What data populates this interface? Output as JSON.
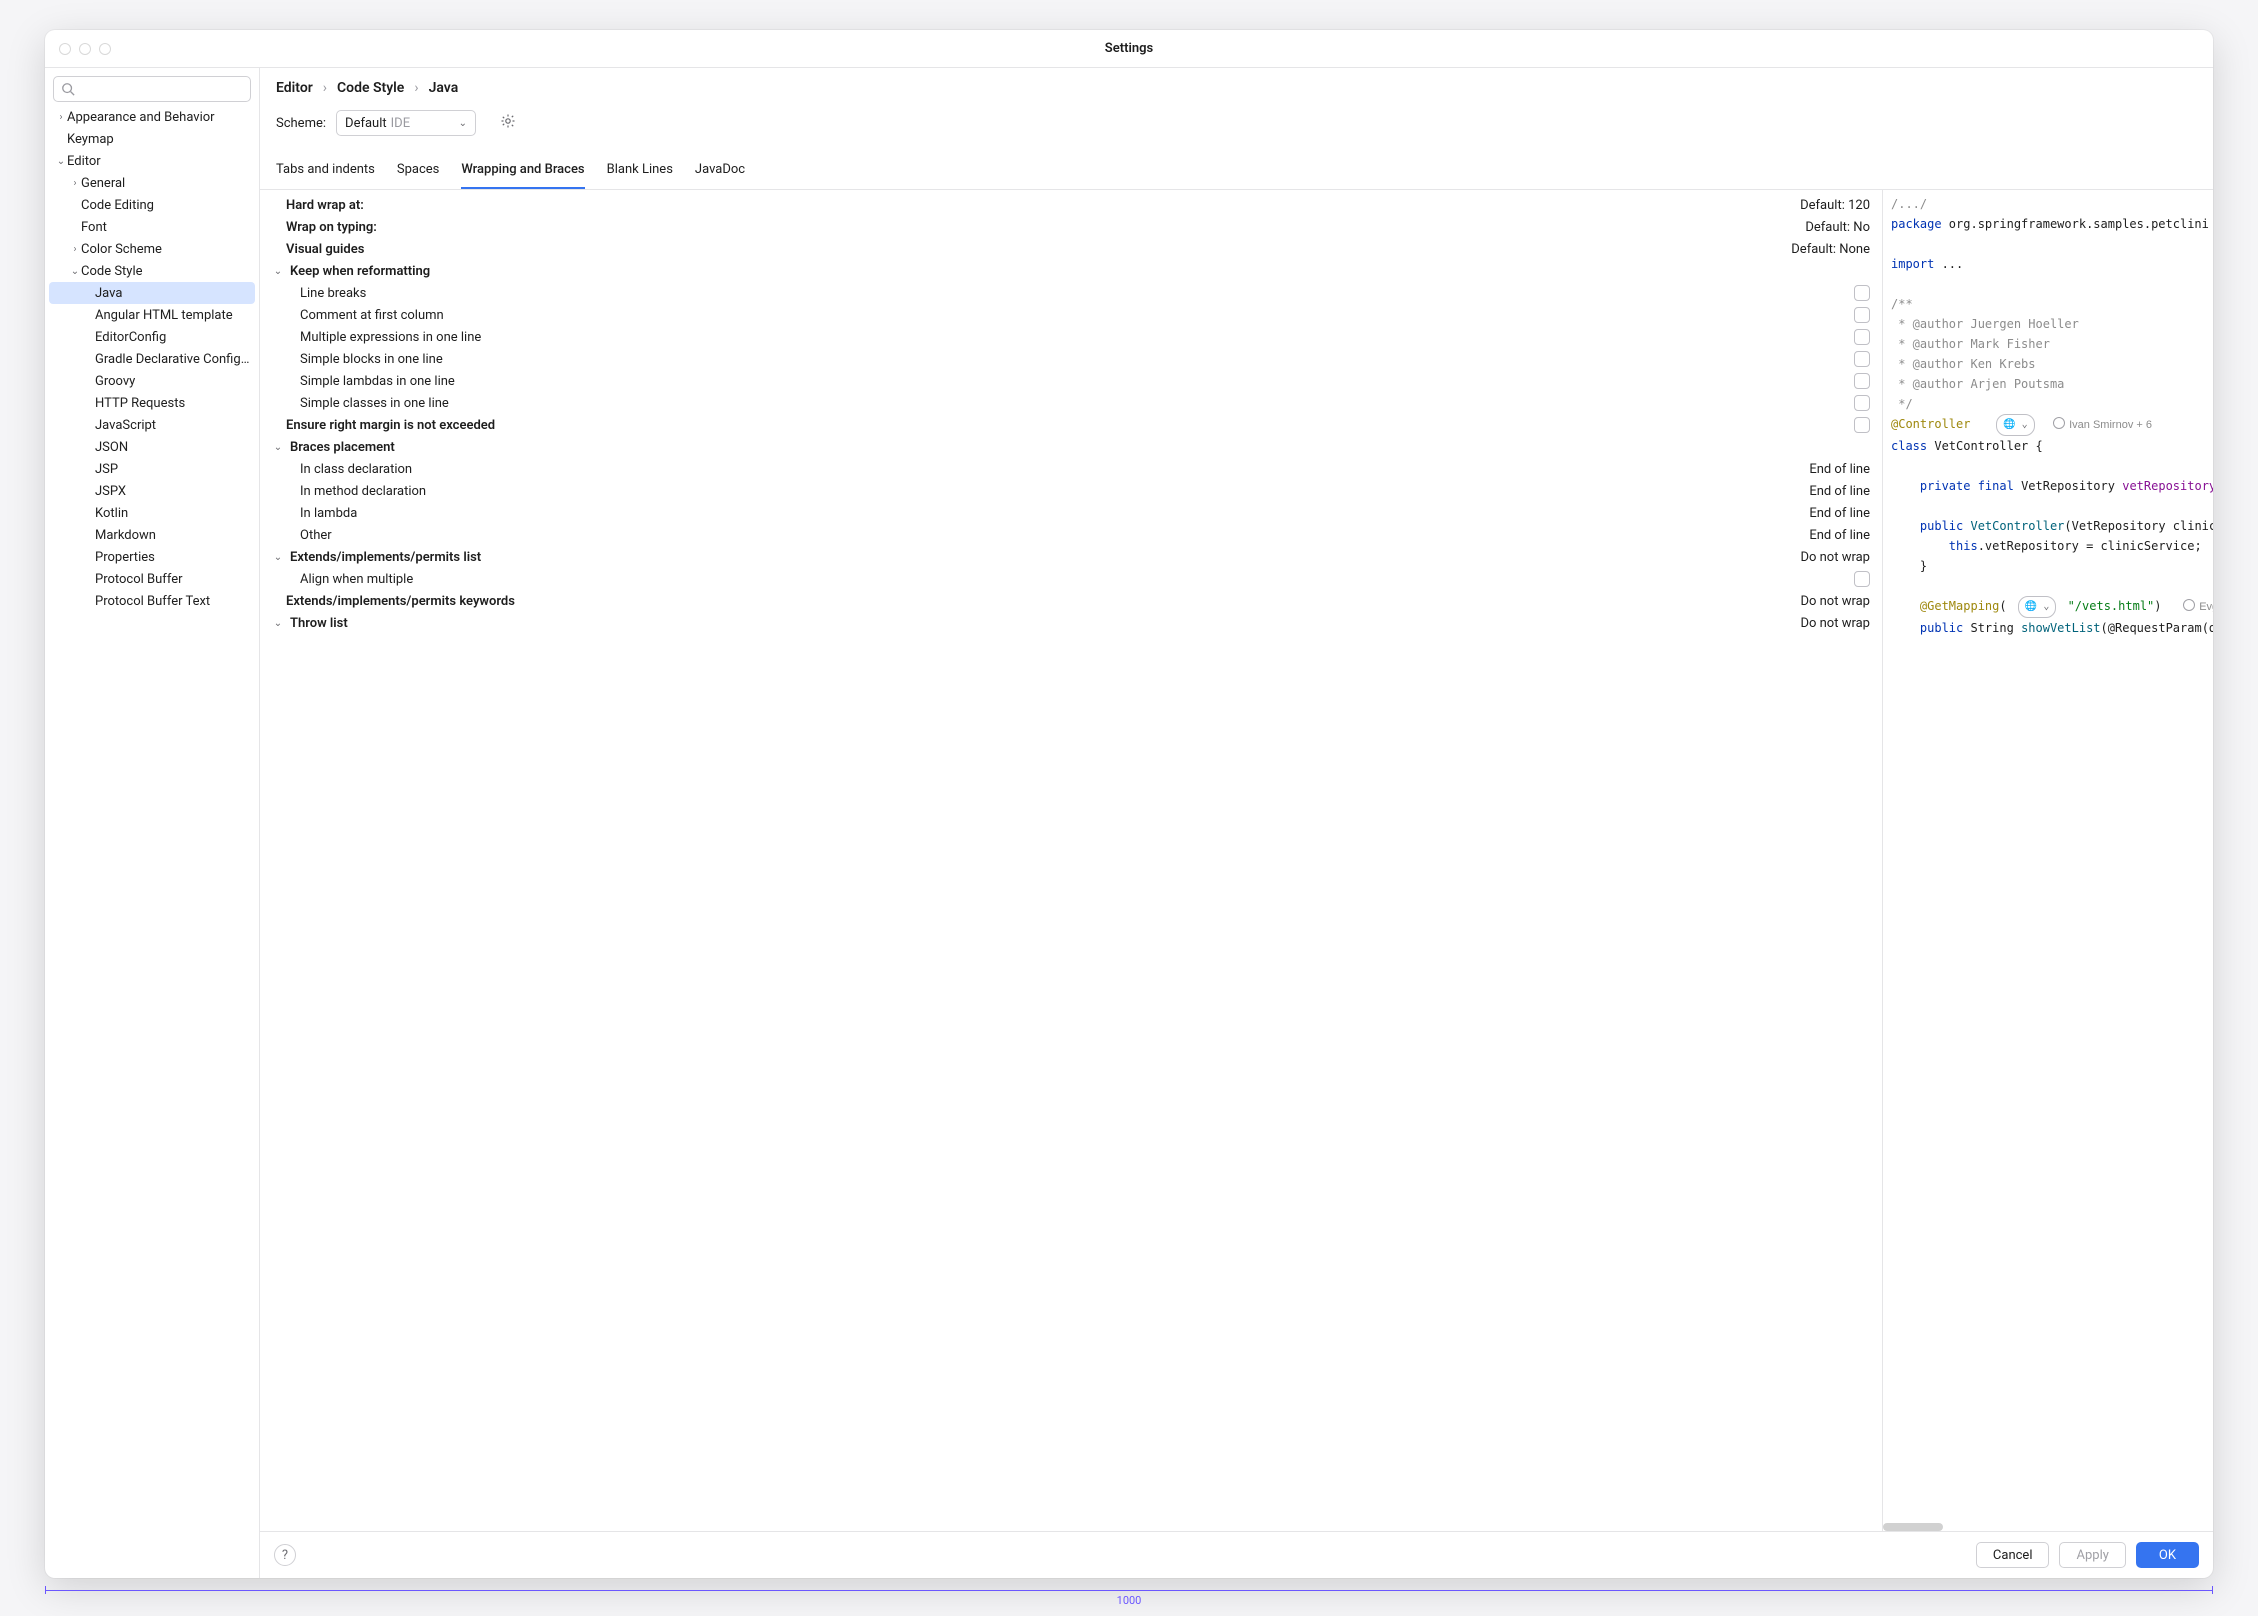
{
  "window_title": "Settings",
  "breadcrumb": [
    "Editor",
    "Code Style",
    "Java"
  ],
  "scheme": {
    "label": "Scheme:",
    "value": "Default",
    "badge": "IDE"
  },
  "search_placeholder": "",
  "sidebar": [
    {
      "label": "Appearance and Behavior",
      "depth": 0,
      "arrow": "right"
    },
    {
      "label": "Keymap",
      "depth": 0,
      "arrow": ""
    },
    {
      "label": "Editor",
      "depth": 0,
      "arrow": "down"
    },
    {
      "label": "General",
      "depth": 1,
      "arrow": "right"
    },
    {
      "label": "Code Editing",
      "depth": 1,
      "arrow": ""
    },
    {
      "label": "Font",
      "depth": 1,
      "arrow": ""
    },
    {
      "label": "Color Scheme",
      "depth": 1,
      "arrow": "right"
    },
    {
      "label": "Code Style",
      "depth": 1,
      "arrow": "down"
    },
    {
      "label": "Java",
      "depth": 2,
      "arrow": "",
      "selected": true
    },
    {
      "label": "Angular HTML template",
      "depth": 2,
      "arrow": ""
    },
    {
      "label": "EditorConfig",
      "depth": 2,
      "arrow": ""
    },
    {
      "label": "Gradle Declarative Configurat",
      "depth": 2,
      "arrow": ""
    },
    {
      "label": "Groovy",
      "depth": 2,
      "arrow": ""
    },
    {
      "label": "HTTP Requests",
      "depth": 2,
      "arrow": ""
    },
    {
      "label": "JavaScript",
      "depth": 2,
      "arrow": ""
    },
    {
      "label": "JSON",
      "depth": 2,
      "arrow": ""
    },
    {
      "label": "JSP",
      "depth": 2,
      "arrow": ""
    },
    {
      "label": "JSPX",
      "depth": 2,
      "arrow": ""
    },
    {
      "label": "Kotlin",
      "depth": 2,
      "arrow": ""
    },
    {
      "label": "Markdown",
      "depth": 2,
      "arrow": ""
    },
    {
      "label": "Properties",
      "depth": 2,
      "arrow": ""
    },
    {
      "label": "Protocol Buffer",
      "depth": 2,
      "arrow": ""
    },
    {
      "label": "Protocol Buffer Text",
      "depth": 2,
      "arrow": ""
    }
  ],
  "tabs": [
    "Tabs and indents",
    "Spaces",
    "Wrapping and Braces",
    "Blank Lines",
    "JavaDoc"
  ],
  "active_tab": 2,
  "options": [
    {
      "label": "Hard wrap at:",
      "bold": true,
      "value": "Default: 120",
      "indent": 0
    },
    {
      "label": "Wrap on typing:",
      "bold": true,
      "value": "Default: No",
      "indent": 0
    },
    {
      "label": "Visual guides",
      "bold": true,
      "value": "Default: None",
      "indent": 0
    },
    {
      "label": "Keep when reformatting",
      "bold": true,
      "arrow": "down",
      "indent": 0
    },
    {
      "label": "Line breaks",
      "check": true,
      "indent": 1
    },
    {
      "label": "Comment at first column",
      "check": true,
      "indent": 1
    },
    {
      "label": "Multiple expressions in one line",
      "check": true,
      "indent": 1
    },
    {
      "label": "Simple blocks in one line",
      "check": true,
      "indent": 1
    },
    {
      "label": "Simple lambdas in one line",
      "check": true,
      "indent": 1
    },
    {
      "label": "Simple classes in one line",
      "check": true,
      "indent": 1
    },
    {
      "label": "Ensure right margin is not exceeded",
      "bold": true,
      "check": true,
      "indent": 0
    },
    {
      "label": "Braces placement",
      "bold": true,
      "arrow": "down",
      "indent": 0
    },
    {
      "label": "In class declaration",
      "value": "End of line",
      "indent": 1
    },
    {
      "label": "In method declaration",
      "value": "End of line",
      "indent": 1
    },
    {
      "label": "In lambda",
      "value": "End of line",
      "indent": 1
    },
    {
      "label": "Other",
      "value": "End of line",
      "indent": 1
    },
    {
      "label": "Extends/implements/permits list",
      "bold": true,
      "arrow": "down",
      "value": "Do not wrap",
      "indent": 0
    },
    {
      "label": "Align when multiple",
      "check": true,
      "indent": 1
    },
    {
      "label": "Extends/implements/permits keywords",
      "bold": true,
      "value": "Do not wrap",
      "indent": 0
    },
    {
      "label": "Throw list",
      "bold": true,
      "arrow": "down",
      "value": "Do not wrap",
      "indent": 0
    }
  ],
  "preview": {
    "comment_top": "/.../",
    "pkg_kw": "package ",
    "pkg_name": "org.springframework.samples.petclini",
    "import_kw": "import ",
    "import_rest": "...",
    "doc_open": "/**",
    "doc_lines": [
      " * @author Juergen Hoeller",
      " * @author Mark Fisher",
      " * @author Ken Krebs",
      " * @author Arjen Poutsma"
    ],
    "doc_close": " */",
    "ann_controller": "@Controller",
    "author1": "Ivan Smirnov + 6",
    "class_kw": "class ",
    "class_name": "VetController {",
    "field_kw1": "private ",
    "field_kw2": "final ",
    "field_type": "VetRepository ",
    "field_name": "vetRepository",
    "ctor_kw": "public ",
    "ctor_name": "VetController",
    "ctor_params": "(VetRepository clinicS",
    "this_kw": "this",
    "this_rest": ".vetRepository = clinicService;",
    "brace_close": "}",
    "ann_get": "@GetMapping",
    "get_str": "\"/vets.html\"",
    "author2": "Evgeni",
    "last_kw1": "public ",
    "last_type": "String ",
    "last_fn": "showVetList",
    "last_rest": "(@RequestParam(de"
  },
  "buttons": {
    "cancel": "Cancel",
    "apply": "Apply",
    "ok": "OK"
  },
  "ruler": {
    "label": "1000"
  }
}
